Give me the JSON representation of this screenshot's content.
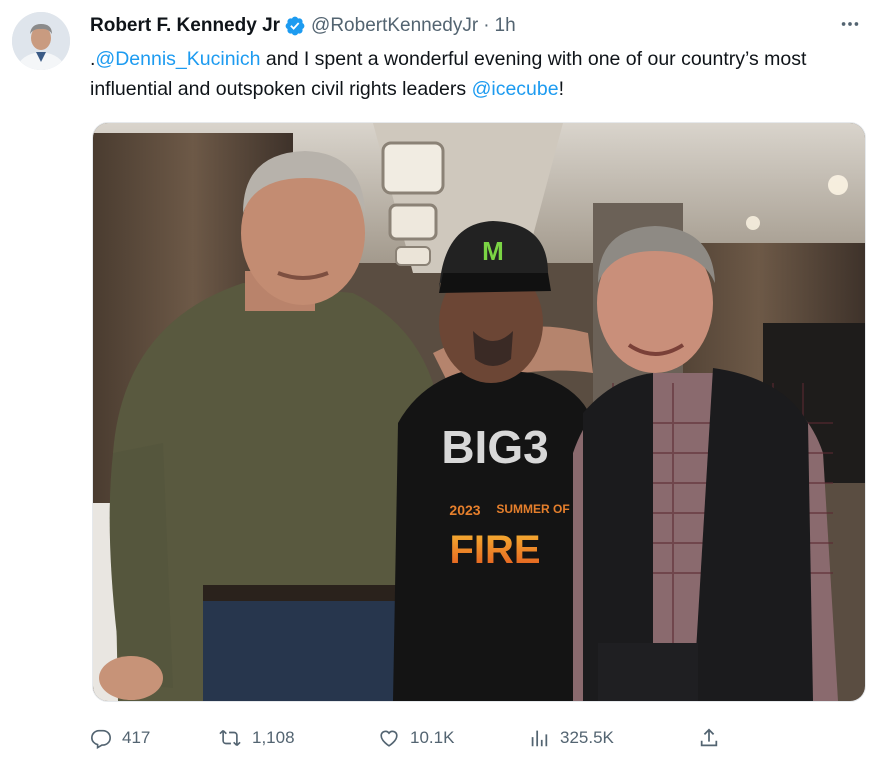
{
  "author": {
    "name": "Robert F. Kennedy Jr",
    "handle": "@RobertKennedyJr",
    "separator": "·",
    "time": "1h",
    "verified_color": "#1d9bf0"
  },
  "tweet": {
    "part1": ".",
    "mention1": "@Dennis_Kucinich",
    "part2": " and I spent a wonderful evening with one of our country’s most influential and outspoken civil rights leaders ",
    "mention2": "@icecube",
    "part3": "!"
  },
  "photo": {
    "cap_logo": "M",
    "shirt_big3": "BIG3",
    "shirt_year": "2023",
    "shirt_summer": "SUMMER OF",
    "shirt_fire": "FIRE"
  },
  "stats": {
    "replies": "417",
    "reposts": "1,108",
    "likes": "10.1K",
    "views": "325.5K"
  },
  "icons": [
    "more-icon",
    "verified-icon",
    "reply-icon",
    "repost-icon",
    "like-icon",
    "views-icon",
    "share-icon"
  ],
  "colors": {
    "accent": "#1d9bf0",
    "muted": "#536471",
    "text": "#0f1419"
  }
}
